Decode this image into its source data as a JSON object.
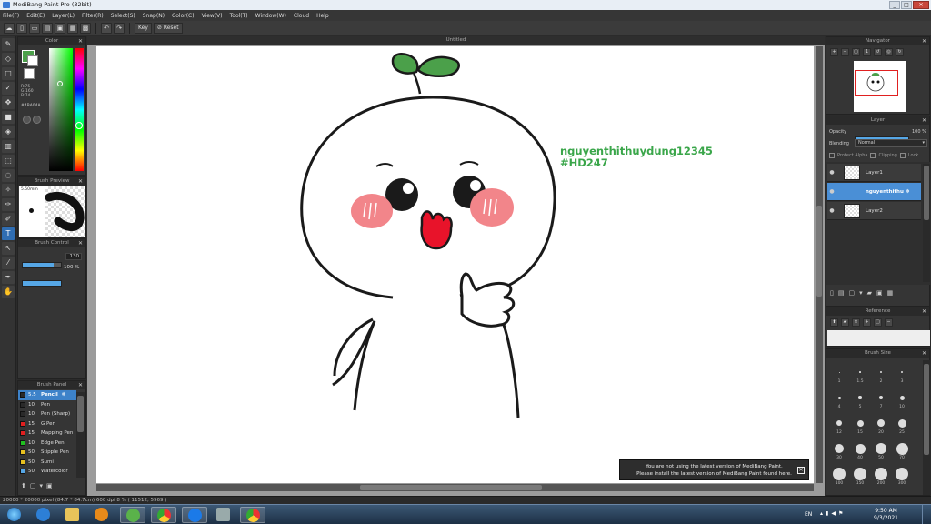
{
  "window": {
    "title": "MediBang Paint Pro (32bit)",
    "min": "_",
    "max": "□",
    "close": "✕"
  },
  "menu": [
    "File(F)",
    "Edit(E)",
    "Layer(L)",
    "Filter(R)",
    "Select(S)",
    "Snap(N)",
    "Color(C)",
    "View(V)",
    "Tool(T)",
    "Window(W)",
    "Cloud",
    "Help"
  ],
  "toolbar": {
    "undo": "↶",
    "redo": "↷",
    "key_label": "Key",
    "reset_label": "Reset"
  },
  "document": {
    "tab_title": "Untitled"
  },
  "watermark": {
    "line1": "nguyenthithuydung12345",
    "line2": "#HD247",
    "color": "#3aa64a"
  },
  "panels": {
    "color": {
      "title": "Color",
      "rgb": [
        "R:75",
        "G:160",
        "B:74"
      ],
      "hex": "#4BA04A",
      "fg_color": "#4ba04a"
    },
    "brush_preview": {
      "title": "Brush Preview",
      "size_label": "5.50mm"
    },
    "brush_control": {
      "title": "Brush Control",
      "size_value": "130",
      "opacity_value": "100 %",
      "size_fill": 0.8,
      "opacity_fill": 1.0
    },
    "brush_panel": {
      "title": "Brush Panel",
      "items": [
        {
          "size": "5.5",
          "name": "Pencil",
          "color": "#2a2a2a",
          "selected": true
        },
        {
          "size": "10",
          "name": "Pen",
          "color": "#2a2a2a",
          "selected": false
        },
        {
          "size": "10",
          "name": "Pen (Sharp)",
          "color": "#2a2a2a",
          "selected": false
        },
        {
          "size": "15",
          "name": "G Pen",
          "color": "#e02020",
          "selected": false
        },
        {
          "size": "15",
          "name": "Mapping Pen",
          "color": "#e02020",
          "selected": false
        },
        {
          "size": "10",
          "name": "Edge Pen",
          "color": "#20c020",
          "selected": false
        },
        {
          "size": "50",
          "name": "Stipple Pen",
          "color": "#e8c020",
          "selected": false
        },
        {
          "size": "50",
          "name": "Sumi",
          "color": "#e8c020",
          "selected": false
        },
        {
          "size": "50",
          "name": "Watercolor",
          "color": "#56a7e6",
          "selected": false
        }
      ]
    },
    "navigator": {
      "title": "Navigator"
    },
    "layer": {
      "title": "Layer",
      "opacity_label": "Opacity",
      "opacity_value": "100 %",
      "opacity_fill": 1.0,
      "blending_label": "Blending",
      "blending_value": "Normal",
      "protect_alpha": "Protect Alpha",
      "clipping": "Clipping",
      "lock": "Lock",
      "layers": [
        {
          "name": "Layer1",
          "selected": false
        },
        {
          "name": "nguyenthithu",
          "selected": true
        },
        {
          "name": "Layer2",
          "selected": false
        }
      ]
    },
    "reference": {
      "title": "Reference"
    },
    "brush_size": {
      "title": "Brush Size",
      "sizes": [
        "1",
        "1.5",
        "2",
        "3",
        "4",
        "5",
        "7",
        "10",
        "12",
        "15",
        "20",
        "25",
        "30",
        "40",
        "50",
        "70",
        "100",
        "150",
        "200",
        "300"
      ]
    }
  },
  "status": {
    "text": "20000 * 20000 pixel  (84.7 * 84.7cm)  600 dpi  8 %  ( 11512, 5969 )"
  },
  "notice": {
    "line1": "You are not using the latest version of MediBang Paint.",
    "line2": "Please install the latest version of MediBang Paint found here."
  },
  "taskbar": {
    "time": "9:50 AM",
    "date": "9/3/2021",
    "lang": "EN"
  }
}
